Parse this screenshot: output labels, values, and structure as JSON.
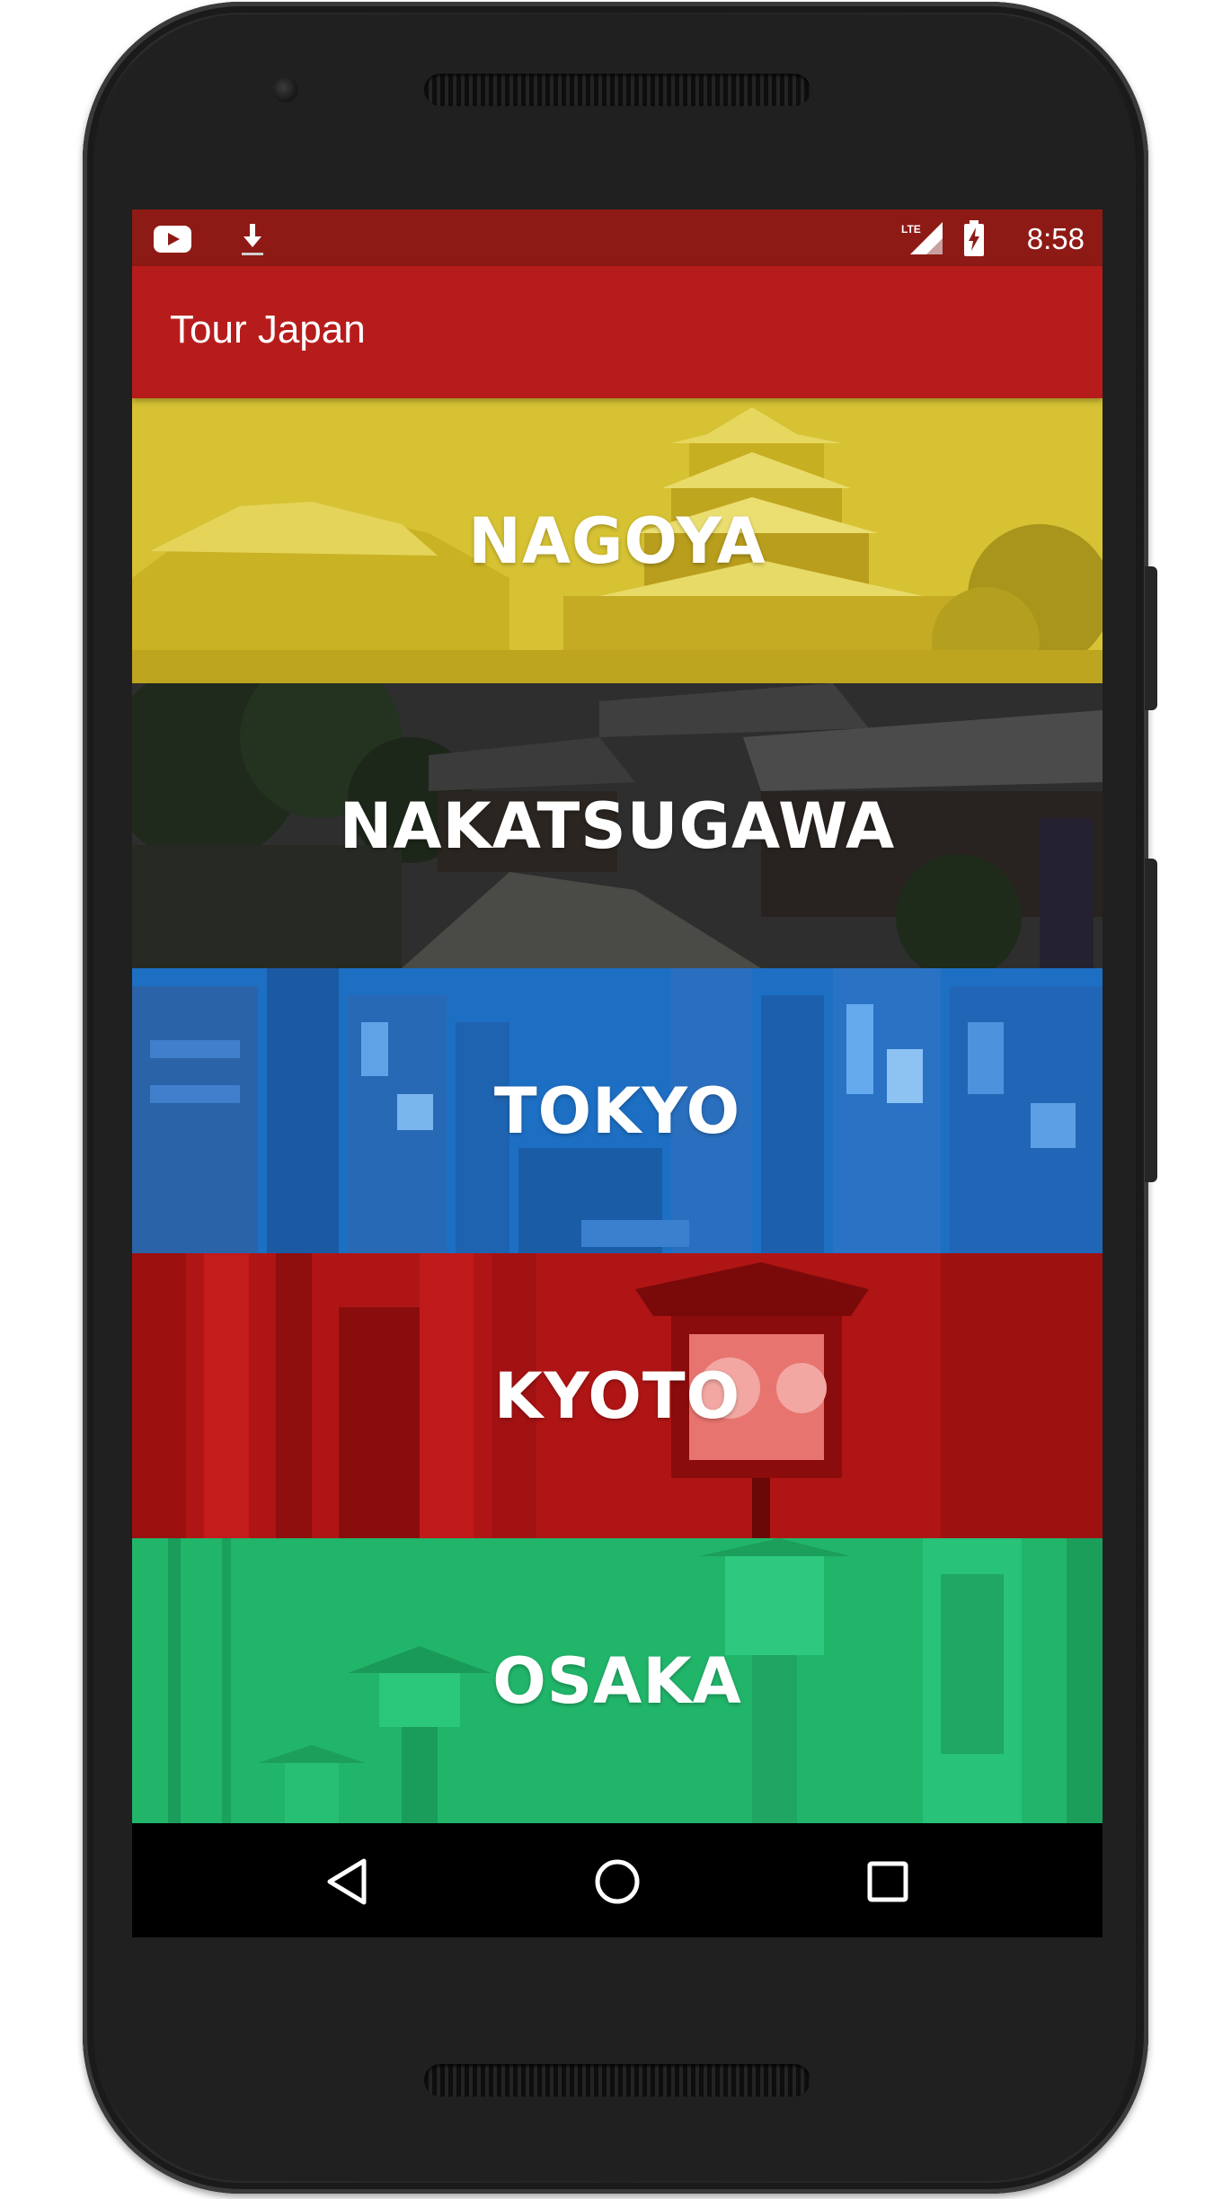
{
  "device": {
    "frame_color": "#232323"
  },
  "status_bar": {
    "background": "#8e1a15",
    "left_icons": [
      "youtube-icon",
      "download-icon"
    ],
    "right_icons": [
      "lte-signal-icon",
      "battery-charging-icon"
    ],
    "network_label": "LTE",
    "time": "8:58"
  },
  "app_bar": {
    "title": "Tour Japan",
    "background": "#b71c1c"
  },
  "cities": [
    {
      "name": "NAGOYA",
      "tint": "#d4c02a",
      "scene": "castle"
    },
    {
      "name": "NAKATSUGAWA",
      "tint": "#2b2b2b",
      "scene": "old-town-street"
    },
    {
      "name": "TOKYO",
      "tint": "#1d6fc4",
      "scene": "neon-city"
    },
    {
      "name": "KYOTO",
      "tint": "#b01515",
      "scene": "torii-lantern"
    },
    {
      "name": "OSAKA",
      "tint": "#21b56a",
      "scene": "stone-lanterns"
    }
  ],
  "nav_bar": {
    "buttons": [
      "back-icon",
      "home-icon",
      "recents-icon"
    ]
  }
}
